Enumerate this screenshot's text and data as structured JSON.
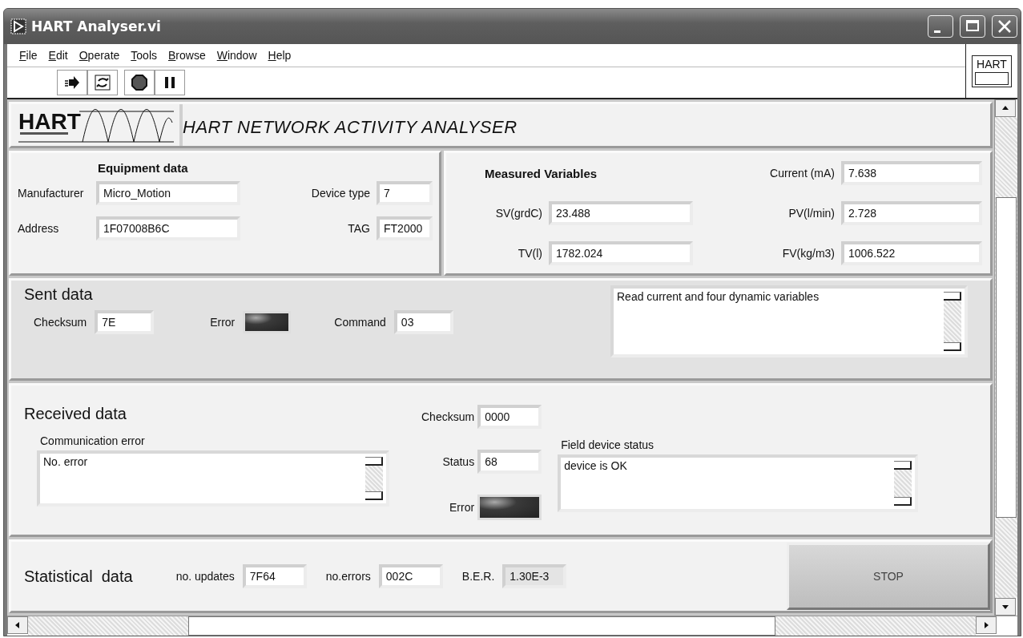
{
  "window": {
    "title": "HART Analyser.vi"
  },
  "menu": [
    "File",
    "Edit",
    "Operate",
    "Tools",
    "Browse",
    "Window",
    "Help"
  ],
  "corner_label": "HART",
  "header": {
    "logo_text": "HART",
    "title": "HART NETWORK ACTIVITY ANALYSER"
  },
  "equipment": {
    "title": "Equipment data",
    "fields": [
      {
        "label": "Manufacturer",
        "value": "Micro_Motion"
      },
      {
        "label": "Device type",
        "value": "7"
      },
      {
        "label": "Address",
        "value": "1F07008B6C"
      },
      {
        "label": "TAG",
        "value": "FT2000"
      }
    ]
  },
  "measured": {
    "title": "Measured Variables",
    "fields": [
      {
        "label": "Current (mA)",
        "value": "7.638"
      },
      {
        "label": "SV(grdC)",
        "value": "23.488"
      },
      {
        "label": "PV(l/min)",
        "value": "2.728"
      },
      {
        "label": "TV(l)",
        "value": "1782.024"
      },
      {
        "label": "FV(kg/m3)",
        "value": "1006.522"
      }
    ]
  },
  "sent": {
    "title": "Sent data",
    "checksum": {
      "label": "Checksum",
      "value": "7E"
    },
    "error": {
      "label": "Error",
      "on": false
    },
    "command": {
      "label": "Command",
      "value": "03"
    },
    "description": "Read current and four dynamic variables"
  },
  "received": {
    "title": "Received data",
    "communication_error": {
      "label": "Communication error",
      "value": "No. error"
    },
    "checksum": {
      "label": "Checksum",
      "value": "0000"
    },
    "status": {
      "label": "Status",
      "value": "68"
    },
    "error": {
      "label": "Error",
      "on": false
    },
    "field_device_status": {
      "label": "Field device status",
      "value": "device is OK"
    }
  },
  "statistics": {
    "title": "Statistical  data",
    "fields": [
      {
        "label": "no. updates",
        "value": "7F64"
      },
      {
        "label": "no.errors",
        "value": "002C"
      },
      {
        "label": "B.E.R.",
        "value": "1.30E-3",
        "disabled": true
      }
    ],
    "stop_button": "STOP"
  }
}
